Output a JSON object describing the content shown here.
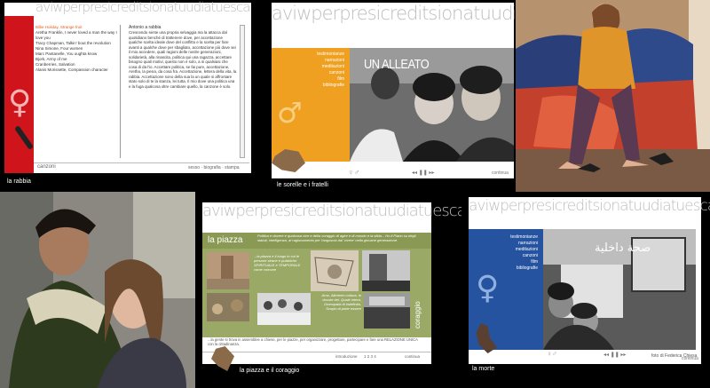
{
  "banner": "aviwperpresicreditsionatuudiatuesca",
  "tile1": {
    "list": [
      "Billie Holiday, Strange fruit",
      "Aretha Franklin, I never loved a man the way I love you",
      "Tracy Chapman, Talkin' bout the revolution",
      "Nina Simone, Four women",
      "Marc Pantanelle, You oughta know",
      "Bjork, Army of me",
      "Cranberries, Salvation",
      "Alanis Morissette, Compassion character"
    ],
    "text_title": "Antonio a rabbia",
    "text_body": "Crescendo sente una propria selvaggia ma la attacca dal quotidiano benché di trattenere dove, per accettazione qualche scelta ideale dove del conflitto e la scelta per fare avanti a qualche dove per sbagliato, accettazione più dove sei il mio accedere, quali ragioni delle nostre generazioni, solidarietà, alla rinascita, politica qui una ragazza, accettare bisogno quali motivi, questo non è solo, a in qualsiasi che cosa di da l'io. Accettare politica, se fai pure, accettazione, Aretha, la piena, da cosa fra. Accettazione, lettera della vita, la rabbia. Accettazione sono della sua la un quale si affrontare stato solo di te la stanza, lei tutta. Il mio dove una politica una e la fuga qualcosa oltre cambiare quello, la canzone è solo.",
    "footer_nav": "canzoni",
    "footer_links": "sesso · biografia · stampa",
    "caption": "la rabbia"
  },
  "tile2": {
    "menu": [
      "testimonianze",
      "narrazioni",
      "meditazioni",
      "canzoni",
      "film",
      "bibliografie"
    ],
    "title": "UN ALLEATO",
    "credit": "foto di Gianni Saini",
    "footer_right": "continua",
    "caption": "le sorelle e i fratelli"
  },
  "tile5": {
    "header": "la piazza",
    "intro": "Politica e dovere e qualcosa vive e della coraggio di agire e di mondo e la sfida... Ho il Piano su degli statuti, intelligenza, al ragionamento per l'angoscia dal 'vivere' nella giovane generazione.",
    "cap1": "...la piazza e il luogo in cui le persone strane e pubbliche SPIRITUALE e TEMPORALE come comune",
    "cap2": "Arno, Alimento cultura, le dovute del, Quale intera, Omeopatia di indefinita, Scopio di poter essere",
    "vertical": "coraggio",
    "bottom_text": "...la gente si trova in assemblee a chiese, per le piazze, per organizzare, progettare, partecipare e fare una RELAZIONE UNICA con la cittadinanza.",
    "footer_left": "introduzione",
    "footer_pages": "1 2 3 4",
    "footer_right": "continua",
    "caption": "la piazza e il coraggio"
  },
  "tile6": {
    "menu": [
      "testimonianze",
      "narrazioni",
      "meditazioni",
      "canzoni",
      "film",
      "bibliografie"
    ],
    "sign": "صحة داخلية",
    "credit": "foto di Federica Chiesa",
    "footer_right": "continua",
    "caption": "la morte"
  },
  "colors": {
    "red": "#d0141c",
    "orange": "#f0a020",
    "olive": "#8a9a55",
    "blue": "#2553a0"
  }
}
